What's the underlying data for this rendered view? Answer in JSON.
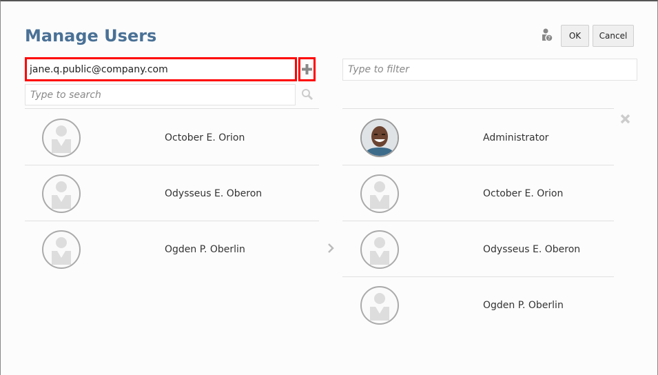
{
  "header": {
    "title": "Manage Users",
    "ok_label": "OK",
    "cancel_label": "Cancel",
    "help_icon": "user-help-icon"
  },
  "left": {
    "email_value": "jane.q.public@company.com",
    "search_placeholder": "Type to search",
    "users": [
      {
        "name": "October E. Orion"
      },
      {
        "name": "Odysseus E. Oberon"
      },
      {
        "name": "Ogden P. Oberlin"
      }
    ]
  },
  "right": {
    "filter_placeholder": "Type to filter",
    "users": [
      {
        "name": "Administrator",
        "photo": true
      },
      {
        "name": "October E. Orion"
      },
      {
        "name": "Odysseus E. Oberon"
      },
      {
        "name": "Ogden P. Oberlin"
      }
    ]
  },
  "colors": {
    "title": "#4a7196",
    "highlight": "#ff0000"
  }
}
